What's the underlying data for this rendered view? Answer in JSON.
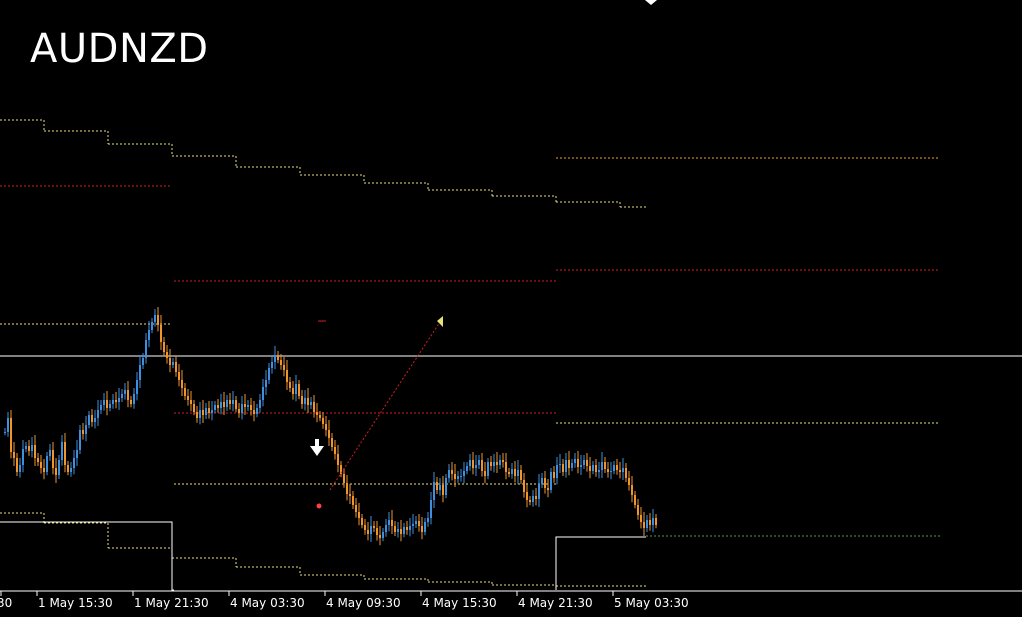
{
  "title": "AUDNZD",
  "colors": {
    "background": "#000000",
    "bull": "#3d8fe0",
    "bear": "#f0952c",
    "level_yellow": "#e8e07a",
    "level_red": "#d02020",
    "level_orange": "#f0a030",
    "level_green": "#5a9a5a",
    "price_line": "#ffffff",
    "axis": "#ffffff"
  },
  "icons": [
    "sell-arrow-icon",
    "marker-triangle-icon",
    "marker-dot-icon"
  ],
  "chart_data": {
    "type": "candlestick",
    "symbol": "AUDNZD",
    "xlabel": "",
    "ylabel": "",
    "grid": false,
    "x_tick_labels": [
      "30",
      "1 May 15:30",
      "1 May 21:30",
      "4 May 03:30",
      "4 May 09:30",
      "4 May 15:30",
      "4 May 21:30",
      "5 May 03:30"
    ],
    "series": [
      {
        "values": [
          438,
          452,
          418,
          412,
          398,
          405,
          421,
          424,
          419,
          425,
          412,
          408,
          402,
          398,
          414,
          420,
          402,
          395,
          410,
          428,
          405,
          398,
          402,
          412,
          420,
          440,
          436,
          445,
          455,
          448,
          452,
          460,
          465,
          470,
          462,
          466,
          470,
          468,
          472,
          476,
          480,
          470,
          466,
          476,
          490,
          505,
          512,
          530,
          540,
          548,
          555,
          545,
          528,
          518,
          512,
          505,
          508,
          498,
          490,
          482,
          474,
          470,
          466,
          458,
          452,
          460,
          455,
          462,
          457,
          460,
          465,
          462,
          468,
          463,
          470,
          466,
          470,
          461,
          457,
          466,
          463,
          465,
          460,
          456,
          462,
          470,
          483,
          490,
          502,
          508,
          515,
          510,
          505,
          500,
          488,
          482,
          476,
          486,
          474,
          466,
          472,
          465,
          468,
          458,
          455,
          452,
          446,
          440,
          432,
          423,
          416,
          405,
          396,
          387,
          376,
          374,
          365,
          358,
          352,
          345,
          340,
          336,
          344,
          342,
          335,
          332,
          338,
          345,
          350,
          344,
          338,
          341,
          336,
          343,
          340,
          344,
          346,
          349,
          344,
          338,
          348,
          352,
          370,
          388,
          380,
          385,
          375,
          392,
          400,
          396,
          391,
          394,
          394,
          399,
          404,
          410,
          402,
          405,
          410,
          399,
          394,
          408,
          404,
          408,
          405,
          410,
          408,
          398,
          396,
          401,
          394,
          400,
          390,
          378,
          370,
          368,
          374,
          371,
          386,
          392,
          382,
          380,
          398,
          392,
          405,
          406,
          398,
          410,
          402,
          407,
          411,
          403,
          405,
          410,
          404,
          399,
          405,
          398,
          400,
          408,
          401,
          398,
          399,
          405,
          400,
          398,
          402,
          392,
          385,
          375,
          365,
          355,
          348,
          342,
          350,
          345,
          352,
          345
        ]
      }
    ],
    "annotations": [
      {
        "type": "sell-arrow",
        "label": "sell signal"
      }
    ]
  }
}
